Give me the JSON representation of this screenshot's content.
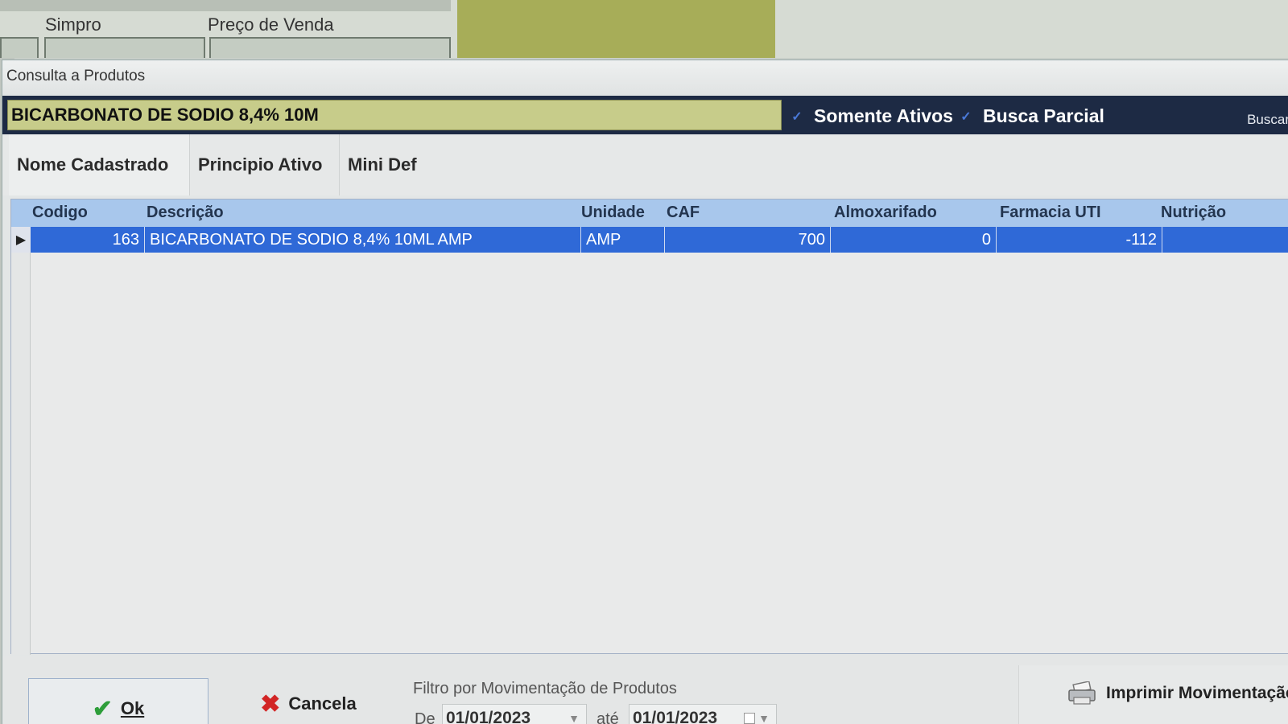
{
  "background_form": {
    "labels": [
      "Simpro",
      "Preço de Venda"
    ]
  },
  "dialog": {
    "title": "Consulta a Produtos",
    "search": {
      "value": "BICARBONATO DE SODIO 8,4% 10M",
      "somente_ativos_label": "Somente Ativos",
      "busca_parcial_label": "Busca Parcial",
      "buscar_label": "Buscar"
    },
    "tabs": [
      {
        "label": "Nome Cadastrado"
      },
      {
        "label": "Principio Ativo"
      },
      {
        "label": "Mini Def"
      }
    ],
    "grid": {
      "columns": [
        "Codigo",
        "Descrição",
        "Unidade",
        "CAF",
        "Almoxarifado",
        "Farmacia UTI",
        "Nutrição"
      ],
      "rows": [
        {
          "codigo": "163",
          "descricao": "BICARBONATO DE SODIO 8,4% 10ML AMP",
          "unidade": "AMP",
          "caf": "700",
          "almoxarifado": "0",
          "farmacia_uti": "-112",
          "nutricao": ""
        }
      ]
    },
    "footer": {
      "ok_label": "Ok",
      "cancel_label": "Cancela",
      "filter_title": "Filtro por Movimentação de Produtos",
      "de_label": "De",
      "date_from": "01/01/2023",
      "ate_label": "até",
      "date_to": "01/01/2023",
      "print_label": "Imprimir Movimentação"
    }
  },
  "colors": {
    "search_bar": "#1d2a44",
    "search_input": "#c7cc8a",
    "grid_header": "#a8c7ec",
    "selected_row": "#2f69d7"
  }
}
